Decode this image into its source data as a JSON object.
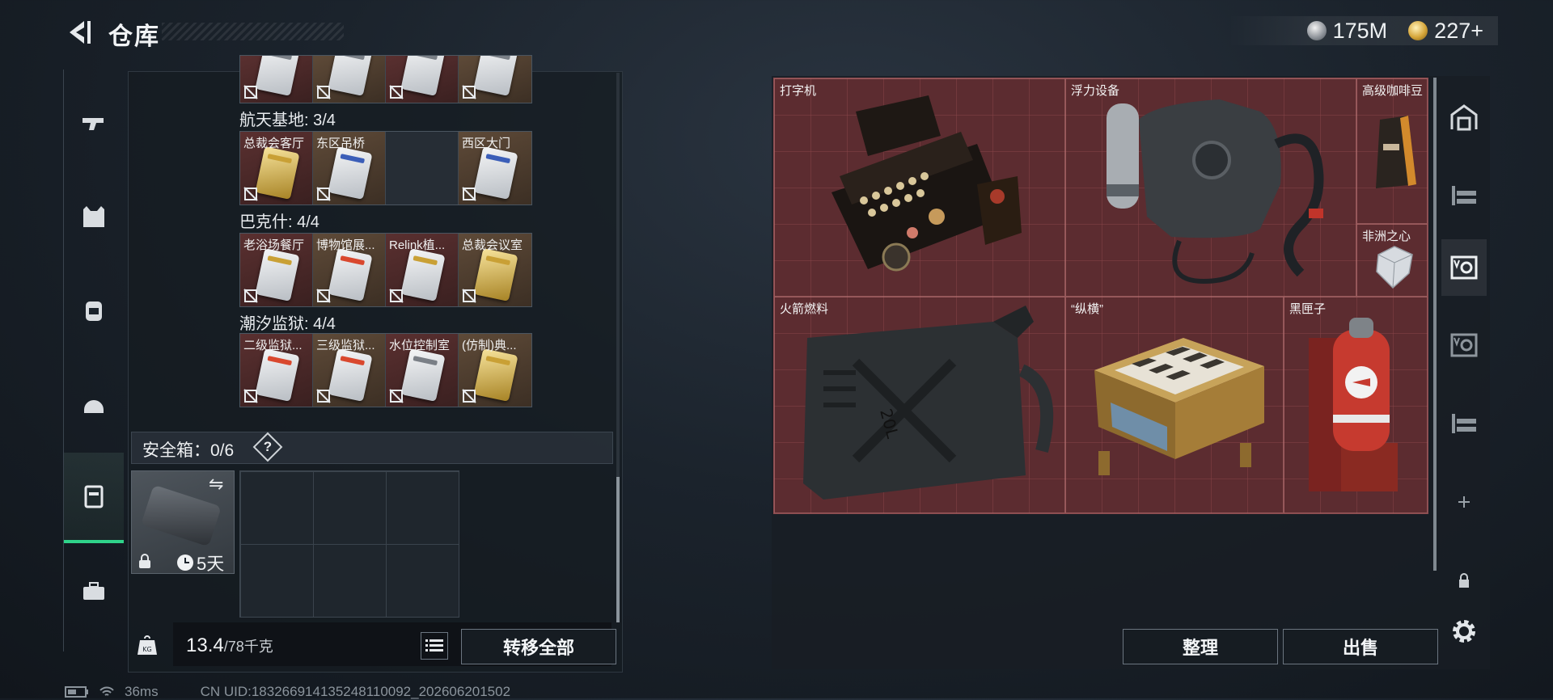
{
  "header": {
    "title": "仓库"
  },
  "currency": [
    {
      "icon": "silver-coin-icon",
      "value": "175M"
    },
    {
      "icon": "gold-coin-icon",
      "value": "227+"
    }
  ],
  "left_tabs": [
    {
      "icon": "gun-icon"
    },
    {
      "icon": "armor-vest-icon"
    },
    {
      "icon": "backpack-icon"
    },
    {
      "icon": "helmet-icon"
    },
    {
      "icon": "safe-box-icon",
      "active": true
    },
    {
      "icon": "toolbox-icon"
    }
  ],
  "keycards": {
    "groups": [
      {
        "label": "",
        "cells": [
          {
            "name": "",
            "card": "white",
            "stripe": "gray",
            "state": "filled"
          },
          {
            "name": "",
            "card": "white",
            "stripe": "gray",
            "state": "filled"
          },
          {
            "name": "",
            "card": "white",
            "stripe": "gray",
            "state": "filled"
          },
          {
            "name": "",
            "card": "white",
            "stripe": "gray",
            "state": "filled"
          }
        ]
      },
      {
        "label": "航天基地: 3/4",
        "cells": [
          {
            "name": "总裁会客厅",
            "card": "gold",
            "stripe": "gold",
            "state": "filled"
          },
          {
            "name": "东区吊桥",
            "card": "white",
            "stripe": "blue",
            "state": "filled"
          },
          {
            "name": "",
            "card": "",
            "stripe": "",
            "state": "empty"
          },
          {
            "name": "西区大门",
            "card": "white",
            "stripe": "blue",
            "state": "filled"
          }
        ]
      },
      {
        "label": "巴克什: 4/4",
        "cells": [
          {
            "name": "老浴场餐厅",
            "card": "white",
            "stripe": "gold",
            "state": "filled"
          },
          {
            "name": "博物馆展...",
            "card": "white",
            "stripe": "red",
            "state": "filled"
          },
          {
            "name": "Relink植...",
            "card": "white",
            "stripe": "gold",
            "state": "filled"
          },
          {
            "name": "总裁会议室",
            "card": "gold",
            "stripe": "gold",
            "state": "filled"
          }
        ]
      },
      {
        "label": "潮汐监狱: 4/4",
        "cells": [
          {
            "name": "二级监狱...",
            "card": "white",
            "stripe": "red",
            "state": "filled"
          },
          {
            "name": "三级监狱...",
            "card": "white",
            "stripe": "red",
            "state": "filled"
          },
          {
            "name": "水位控制室",
            "card": "white",
            "stripe": "gray",
            "state": "filled"
          },
          {
            "name": "(仿制)典...",
            "card": "gold",
            "stripe": "gold",
            "state": "filled"
          }
        ]
      }
    ]
  },
  "safe_box": {
    "label": "安全箱：0/6",
    "help": "?",
    "timer": "5天"
  },
  "weight": {
    "current": "13.4",
    "capacity": "/78千克",
    "icon": "weight-kg-icon"
  },
  "buttons": {
    "transfer_all": "转移全部",
    "organize": "整理",
    "sell": "出售"
  },
  "status": {
    "ping": "36ms",
    "uid": "CN UID:18326691413524811009​2_202606201502"
  },
  "inventory": [
    {
      "name": "打字机",
      "icon": "typewriter-icon"
    },
    {
      "name": "浮力设备",
      "icon": "buoyancy-device-icon"
    },
    {
      "name": "高级咖啡豆",
      "icon": "coffee-bag-icon"
    },
    {
      "name": "非洲之心",
      "icon": "diamond-icon"
    },
    {
      "name": "火箭燃料",
      "icon": "fuel-canister-icon"
    },
    {
      "name": "“纵横”",
      "icon": "chess-board-icon"
    },
    {
      "name": "黑匣子",
      "icon": "black-box-icon"
    }
  ],
  "right_tabs": [
    {
      "icon": "stash-home-icon"
    },
    {
      "icon": "shelf-icon"
    },
    {
      "icon": "storage-v-icon-active",
      "active": true
    },
    {
      "icon": "storage-v-icon"
    },
    {
      "icon": "shelf-icon-2"
    },
    {
      "icon": "add-icon"
    },
    {
      "icon": "lock-icon"
    },
    {
      "icon": "settings-gear-icon"
    }
  ],
  "colors": {
    "accent_green": "#2fd38a",
    "item_red": "#5c2c30"
  }
}
